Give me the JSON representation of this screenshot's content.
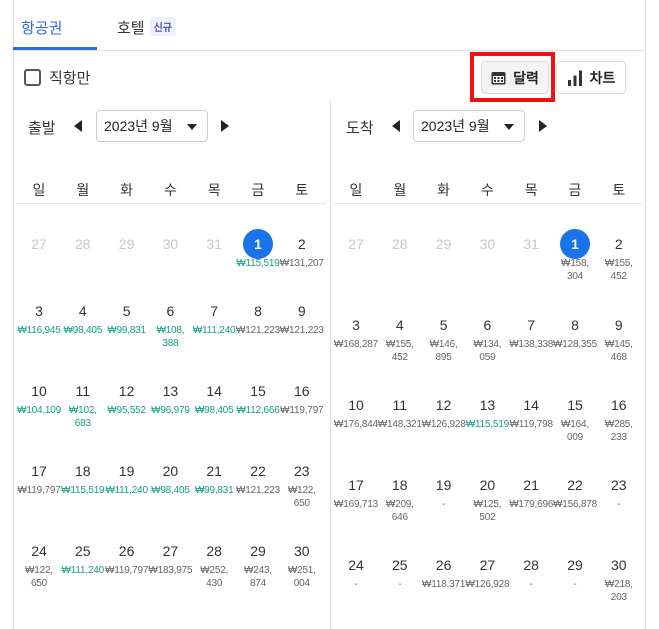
{
  "tabs": [
    {
      "label": "항공권",
      "active": true
    },
    {
      "label": "호텔",
      "badge": "신규"
    }
  ],
  "direct_only": {
    "label": "직항만",
    "checked": false
  },
  "view": {
    "calendar_label": "달력",
    "chart_label": "차트",
    "active": "calendar"
  },
  "colors": {
    "accent": "#2d6bd8",
    "selected": "#1a73e8",
    "cheap_price": "#16a085",
    "highlight": "#ee1111"
  },
  "weekdays": [
    "일",
    "월",
    "화",
    "수",
    "목",
    "금",
    "토"
  ],
  "departure": {
    "label": "출발",
    "month": "2023년 9월",
    "weeks": [
      [
        {
          "d": "27",
          "m": true
        },
        {
          "d": "28",
          "m": true
        },
        {
          "d": "29",
          "m": true
        },
        {
          "d": "30",
          "m": true
        },
        {
          "d": "31",
          "m": true
        },
        {
          "d": "1",
          "s": true,
          "p": "₩115,519",
          "c": true
        },
        {
          "d": "2",
          "p": "₩131,207"
        }
      ],
      [
        {
          "d": "3",
          "p": "₩116,945",
          "c": true
        },
        {
          "d": "4",
          "p": "₩98,405",
          "c": true
        },
        {
          "d": "5",
          "p": "₩99,831",
          "c": true
        },
        {
          "d": "6",
          "p": "₩108,\n388",
          "c": true
        },
        {
          "d": "7",
          "p": "₩111,240",
          "c": true
        },
        {
          "d": "8",
          "p": "₩121,223"
        },
        {
          "d": "9",
          "p": "₩121,223"
        }
      ],
      [
        {
          "d": "10",
          "p": "₩104,109",
          "c": true
        },
        {
          "d": "11",
          "p": "₩102,\n683",
          "c": true
        },
        {
          "d": "12",
          "p": "₩95,552",
          "c": true
        },
        {
          "d": "13",
          "p": "₩96,979",
          "c": true
        },
        {
          "d": "14",
          "p": "₩98,405",
          "c": true
        },
        {
          "d": "15",
          "p": "₩112,666",
          "c": true
        },
        {
          "d": "16",
          "p": "₩119,797"
        }
      ],
      [
        {
          "d": "17",
          "p": "₩119,797"
        },
        {
          "d": "18",
          "p": "₩115,519",
          "c": true
        },
        {
          "d": "19",
          "p": "₩111,240",
          "c": true
        },
        {
          "d": "20",
          "p": "₩98,405",
          "c": true
        },
        {
          "d": "21",
          "p": "₩99,831",
          "c": true
        },
        {
          "d": "22",
          "p": "₩121,223"
        },
        {
          "d": "23",
          "p": "₩122,\n650"
        }
      ],
      [
        {
          "d": "24",
          "p": "₩122,\n650"
        },
        {
          "d": "25",
          "p": "₩111,240",
          "c": true
        },
        {
          "d": "26",
          "p": "₩119,797"
        },
        {
          "d": "27",
          "p": "₩183,975"
        },
        {
          "d": "28",
          "p": "₩252,\n430"
        },
        {
          "d": "29",
          "p": "₩243,\n874"
        },
        {
          "d": "30",
          "p": "₩251,\n004"
        }
      ]
    ]
  },
  "arrival": {
    "label": "도착",
    "month": "2023년 9월",
    "weeks": [
      [
        {
          "d": "27",
          "m": true
        },
        {
          "d": "28",
          "m": true
        },
        {
          "d": "29",
          "m": true
        },
        {
          "d": "30",
          "m": true
        },
        {
          "d": "31",
          "m": true
        },
        {
          "d": "1",
          "s": true,
          "p": "₩158,\n304"
        },
        {
          "d": "2",
          "p": "₩155,\n452"
        }
      ],
      [
        {
          "d": "3",
          "p": "₩168,287"
        },
        {
          "d": "4",
          "p": "₩155,\n452"
        },
        {
          "d": "5",
          "p": "₩146,\n895"
        },
        {
          "d": "6",
          "p": "₩134,\n059"
        },
        {
          "d": "7",
          "p": "₩138,338"
        },
        {
          "d": "8",
          "p": "₩128,355"
        },
        {
          "d": "9",
          "p": "₩145,\n468"
        }
      ],
      [
        {
          "d": "10",
          "p": "₩176,844"
        },
        {
          "d": "11",
          "p": "₩148,321"
        },
        {
          "d": "12",
          "p": "₩126,928"
        },
        {
          "d": "13",
          "p": "₩115,519",
          "c": true
        },
        {
          "d": "14",
          "p": "₩119,798"
        },
        {
          "d": "15",
          "p": "₩164,\n009"
        },
        {
          "d": "16",
          "p": "₩285,\n233"
        }
      ],
      [
        {
          "d": "17",
          "p": "₩169,713"
        },
        {
          "d": "18",
          "p": "₩209,\n646"
        },
        {
          "d": "19",
          "p": "-"
        },
        {
          "d": "20",
          "p": "₩125,\n502"
        },
        {
          "d": "21",
          "p": "₩179,696"
        },
        {
          "d": "22",
          "p": "₩156,878"
        },
        {
          "d": "23",
          "p": "-"
        }
      ],
      [
        {
          "d": "24",
          "p": "-"
        },
        {
          "d": "25",
          "p": "-"
        },
        {
          "d": "26",
          "p": "₩118,371"
        },
        {
          "d": "27",
          "p": "₩126,928"
        },
        {
          "d": "28",
          "p": "-"
        },
        {
          "d": "29",
          "p": "-"
        },
        {
          "d": "30",
          "p": "₩218,\n203"
        }
      ]
    ]
  }
}
